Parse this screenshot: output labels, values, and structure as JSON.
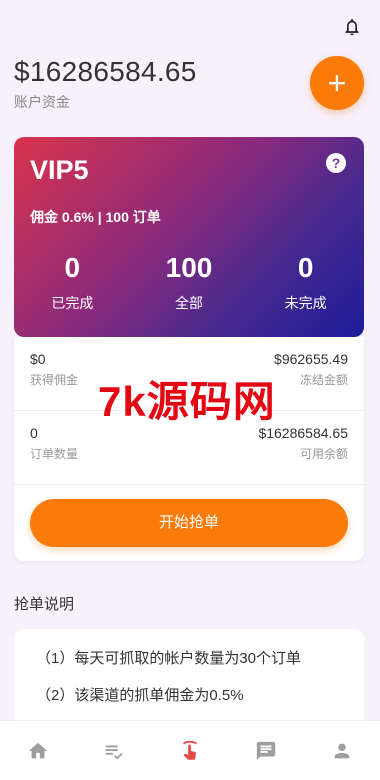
{
  "header": {
    "balance": "$16286584.65",
    "balance_label": "账户资金"
  },
  "vip": {
    "level": "VIP5",
    "commission": "佣金 0.6% | 100 订单",
    "stats": [
      {
        "value": "0",
        "label": "已完成"
      },
      {
        "value": "100",
        "label": "全部"
      },
      {
        "value": "0",
        "label": "未完成"
      }
    ]
  },
  "info": {
    "earned": {
      "value": "$0",
      "label": "获得佣金"
    },
    "frozen": {
      "value": "$962655.49",
      "label": "冻结金额"
    },
    "orders": {
      "value": "0",
      "label": "订单数量"
    },
    "available": {
      "value": "$16286584.65",
      "label": "可用余额"
    }
  },
  "start_button": "开始抢单",
  "watermark": "7k源码网",
  "rules": {
    "title": "抢单说明",
    "items": [
      "（1）每天可抓取的帐户数量为30个订单",
      "（2）该渠道的抓单佣金为0.5%"
    ]
  },
  "tabs": [
    "home-icon",
    "orders-icon",
    "grab-icon",
    "messages-icon",
    "profile-icon"
  ],
  "colors": {
    "accent": "#fa7a0a",
    "grab_tab": "#e84a4a",
    "tab_inactive": "#9e9e9e"
  }
}
